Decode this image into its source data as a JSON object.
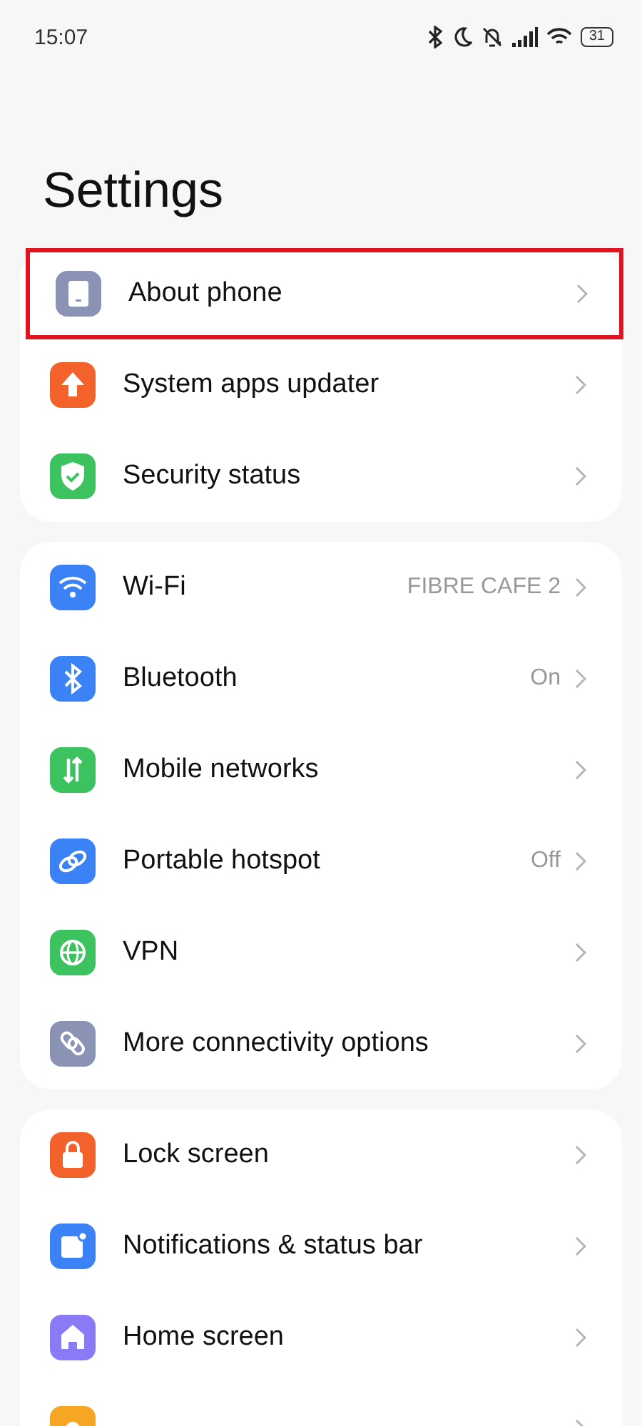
{
  "status_bar": {
    "time": "15:07",
    "battery": "31"
  },
  "title": "Settings",
  "groups": [
    {
      "items": [
        {
          "kind": "phone",
          "label": "About phone",
          "highlighted": true
        },
        {
          "kind": "update",
          "label": "System apps updater",
          "highlighted": false
        },
        {
          "kind": "shield",
          "label": "Security status",
          "highlighted": false
        }
      ]
    },
    {
      "items": [
        {
          "kind": "wifi",
          "label": "Wi-Fi",
          "value": "FIBRE CAFE 2",
          "highlighted": false
        },
        {
          "kind": "bluetooth",
          "label": "Bluetooth",
          "value": "On",
          "highlighted": false
        },
        {
          "kind": "mobile",
          "label": "Mobile networks",
          "highlighted": false
        },
        {
          "kind": "hotspot",
          "label": "Portable hotspot",
          "value": "Off",
          "highlighted": false
        },
        {
          "kind": "vpn",
          "label": "VPN",
          "highlighted": false
        },
        {
          "kind": "link",
          "label": "More connectivity options",
          "highlighted": false
        }
      ]
    },
    {
      "items": [
        {
          "kind": "lock",
          "label": "Lock screen",
          "highlighted": false
        },
        {
          "kind": "notify",
          "label": "Notifications & status bar",
          "highlighted": false
        },
        {
          "kind": "home",
          "label": "Home screen",
          "highlighted": false
        },
        {
          "kind": "sun",
          "highlighted": false
        }
      ]
    }
  ]
}
